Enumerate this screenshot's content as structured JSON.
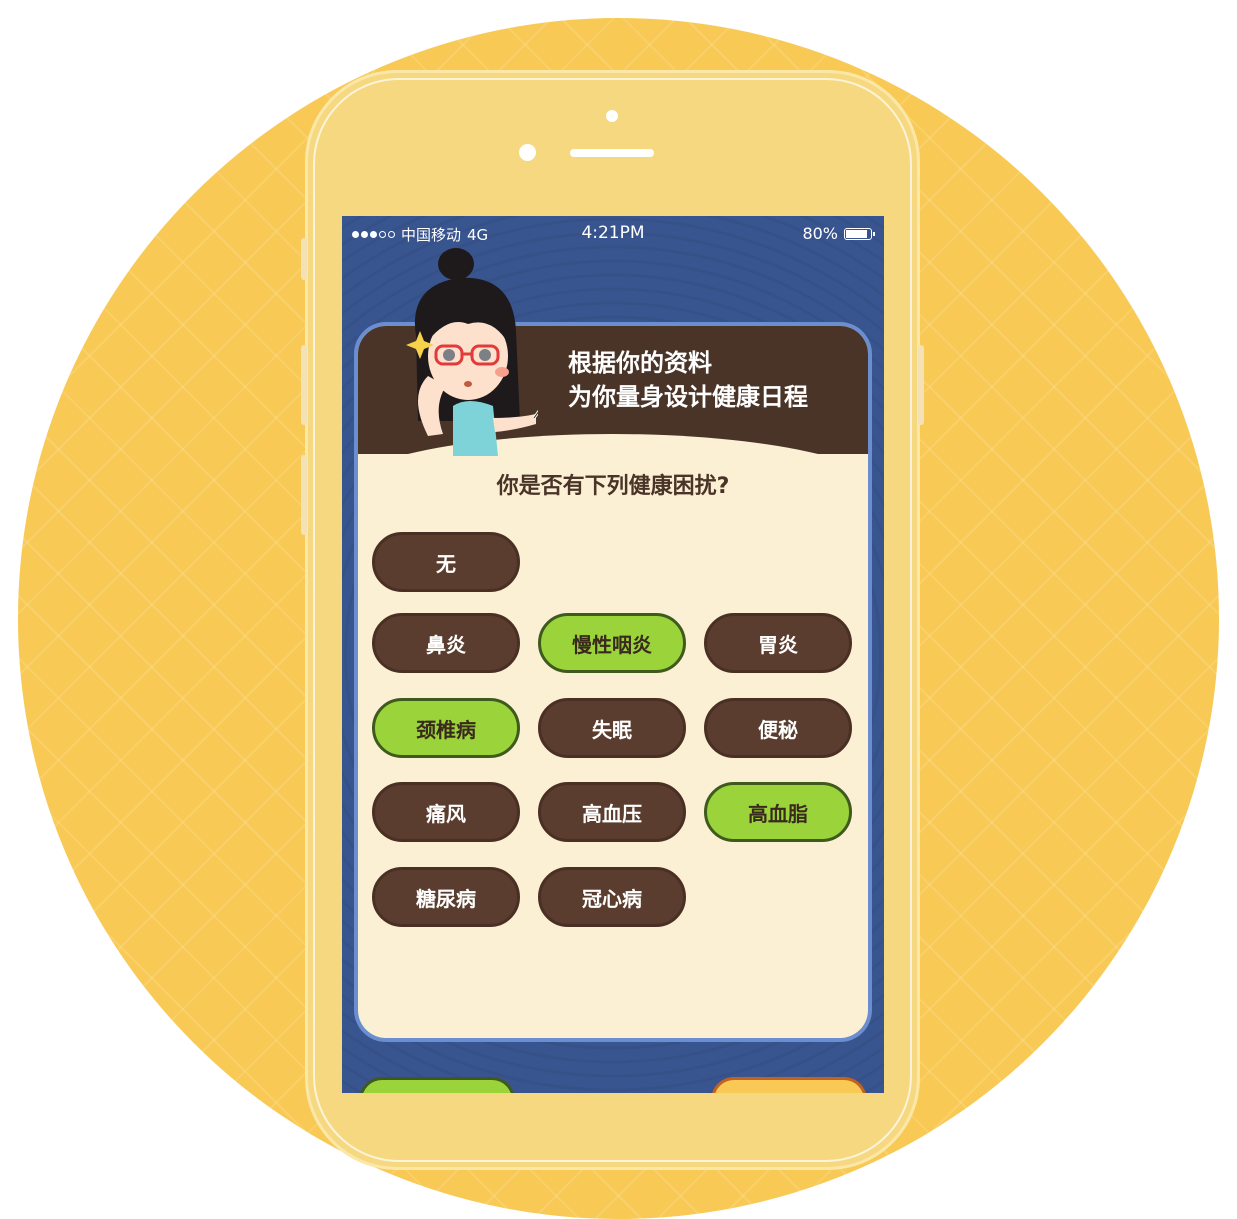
{
  "status_bar": {
    "carrier": "中国移动",
    "network": "4G",
    "time": "4:21PM",
    "battery": "80%"
  },
  "header": {
    "line1": "根据你的资料",
    "line2": "为你量身设计健康日程"
  },
  "question": "你是否有下列健康困扰?",
  "options": [
    {
      "label": "无",
      "selected": false
    },
    {
      "label": "鼻炎",
      "selected": false
    },
    {
      "label": "慢性咽炎",
      "selected": true
    },
    {
      "label": "胃炎",
      "selected": false
    },
    {
      "label": "颈椎病",
      "selected": true
    },
    {
      "label": "失眠",
      "selected": false
    },
    {
      "label": "便秘",
      "selected": false
    },
    {
      "label": "痛风",
      "selected": false
    },
    {
      "label": "高血压",
      "selected": false
    },
    {
      "label": "高血脂",
      "selected": true
    },
    {
      "label": "糖尿病",
      "selected": false
    },
    {
      "label": "冠心病",
      "selected": false
    }
  ],
  "colors": {
    "option_default": "#5a3d2e",
    "option_selected": "#9bd43a",
    "screen_bg": "#39558f",
    "card_bg": "#fcf0d4"
  }
}
